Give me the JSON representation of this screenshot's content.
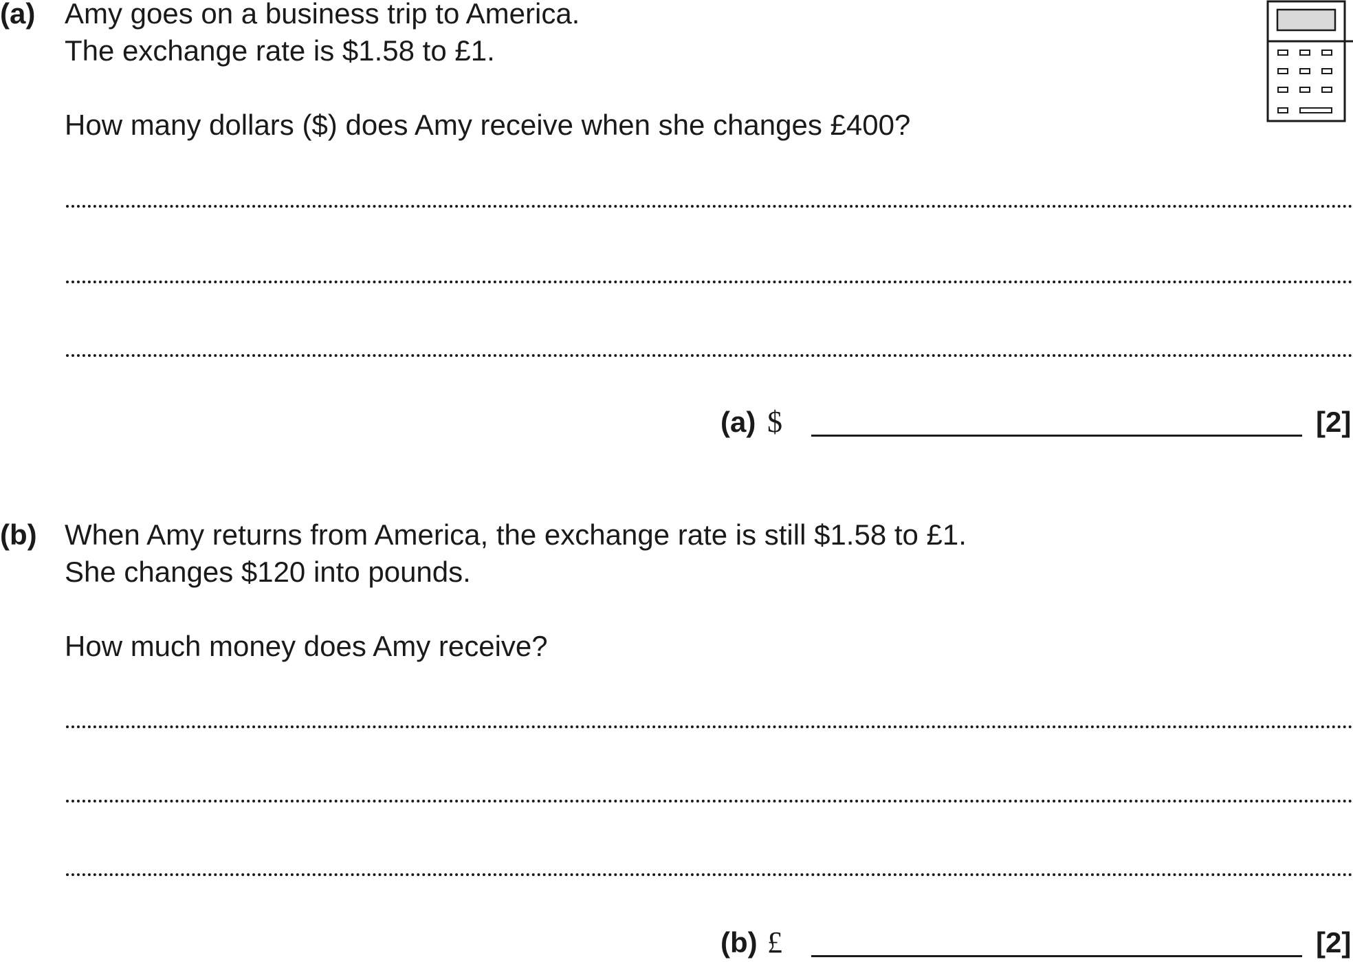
{
  "part_a": {
    "label": "(a)",
    "lines": [
      "Amy goes on a business trip to America.",
      "The exchange rate is $1.58 to £1."
    ],
    "question": "How many dollars ($) does Amy receive when she changes £400?",
    "answer_label": "(a)",
    "answer_unit": "$",
    "marks": "[2]"
  },
  "part_b": {
    "label": "(b)",
    "lines": [
      "When Amy returns from America, the exchange rate is still $1.58 to £1.",
      "She changes $120 into pounds."
    ],
    "question": "How much money does Amy receive?",
    "answer_label": "(b)",
    "answer_unit": "£",
    "marks": "[2]"
  },
  "icons": {
    "calculator": "calculator-icon"
  }
}
